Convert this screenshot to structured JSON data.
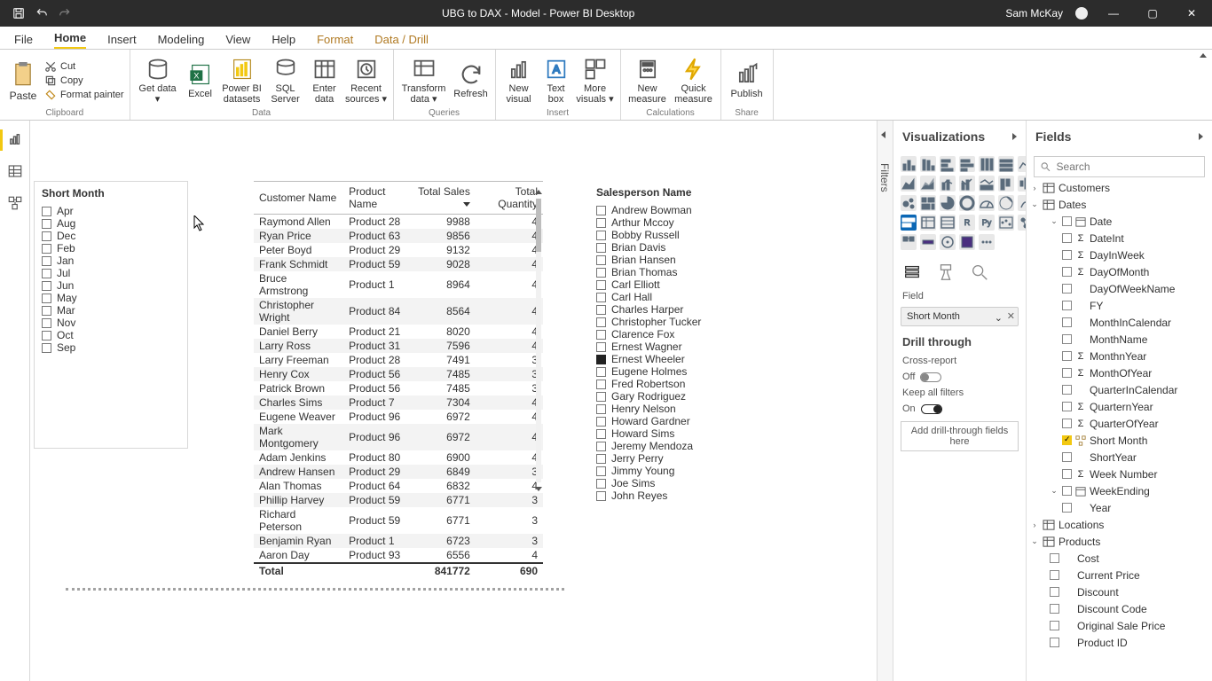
{
  "titlebar": {
    "title": "UBG to DAX - Model - Power BI Desktop",
    "user": "Sam McKay"
  },
  "tabs": {
    "file": "File",
    "home": "Home",
    "insert": "Insert",
    "modeling": "Modeling",
    "view": "View",
    "help": "Help",
    "format": "Format",
    "drill": "Data / Drill"
  },
  "ribbon": {
    "paste": "Paste",
    "cut": "Cut",
    "copy": "Copy",
    "painter": "Format painter",
    "clipboard": "Clipboard",
    "get_data": "Get data",
    "excel": "Excel",
    "pbi_ds": "Power BI datasets",
    "sql": "SQL Server",
    "enter": "Enter data",
    "recent": "Recent sources",
    "data": "Data",
    "transform": "Transform data",
    "refresh": "Refresh",
    "queries": "Queries",
    "new_visual": "New visual",
    "textbox": "Text box",
    "more_vis": "More visuals",
    "insert": "Insert",
    "new_measure": "New measure",
    "quick_measure": "Quick measure",
    "calculations": "Calculations",
    "publish": "Publish",
    "share": "Share"
  },
  "filters_tab": "Filters",
  "viz": {
    "header": "Visualizations",
    "field_section": "Field",
    "field_chip": "Short Month",
    "drill_header": "Drill through",
    "cross": "Cross-report",
    "off": "Off",
    "keep": "Keep all filters",
    "on": "On",
    "drop": "Add drill-through fields here"
  },
  "fields": {
    "header": "Fields",
    "search_ph": "Search",
    "tables": {
      "customers": "Customers",
      "dates": "Dates",
      "date": "Date",
      "dateint": "DateInt",
      "dayinweek": "DayInWeek",
      "dayofmonth": "DayOfMonth",
      "dayofweekname": "DayOfWeekName",
      "fy": "FY",
      "monthincalendar": "MonthInCalendar",
      "monthname": "MonthName",
      "monthnyear": "MonthnYear",
      "monthofyear": "MonthOfYear",
      "qic": "QuarterInCalendar",
      "qny": "QuarternYear",
      "qoy": "QuarterOfYear",
      "shortmonth": "Short Month",
      "shortyear": "ShortYear",
      "weeknum": "Week Number",
      "weekending": "WeekEnding",
      "year": "Year",
      "locations": "Locations",
      "products": "Products",
      "cost": "Cost",
      "curprice": "Current Price",
      "discount": "Discount",
      "disccode": "Discount Code",
      "origprice": "Original Sale Price",
      "productid": "Product ID"
    }
  },
  "slicer_month": {
    "title": "Short Month",
    "items": [
      "Apr",
      "Aug",
      "Dec",
      "Feb",
      "Jan",
      "Jul",
      "Jun",
      "May",
      "Mar",
      "Nov",
      "Oct",
      "Sep"
    ]
  },
  "slicer_sales": {
    "title": "Salesperson Name",
    "items": [
      "Andrew Bowman",
      "Arthur Mccoy",
      "Bobby Russell",
      "Brian Davis",
      "Brian Hansen",
      "Brian Thomas",
      "Carl Elliott",
      "Carl Hall",
      "Charles Harper",
      "Christopher Tucker",
      "Clarence Fox",
      "Ernest Wagner",
      "Ernest Wheeler",
      "Eugene Holmes",
      "Fred Robertson",
      "Gary Rodriguez",
      "Henry Nelson",
      "Howard Gardner",
      "Howard Sims",
      "Jeremy Mendoza",
      "Jerry Perry",
      "Jimmy Young",
      "Joe Sims",
      "John Reyes"
    ],
    "selected_index": 12
  },
  "data_table": {
    "cols": [
      "Customer Name",
      "Product Name",
      "Total Sales",
      "Total Quantity"
    ],
    "rows": [
      [
        "Raymond Allen",
        "Product 28",
        "9988",
        "4"
      ],
      [
        "Ryan Price",
        "Product 63",
        "9856",
        "4"
      ],
      [
        "Peter Boyd",
        "Product 29",
        "9132",
        "4"
      ],
      [
        "Frank Schmidt",
        "Product 59",
        "9028",
        "4"
      ],
      [
        "Bruce Armstrong",
        "Product 1",
        "8964",
        "4"
      ],
      [
        "Christopher Wright",
        "Product 84",
        "8564",
        "4"
      ],
      [
        "Daniel Berry",
        "Product 21",
        "8020",
        "4"
      ],
      [
        "Larry Ross",
        "Product 31",
        "7596",
        "4"
      ],
      [
        "Larry Freeman",
        "Product 28",
        "7491",
        "3"
      ],
      [
        "Henry Cox",
        "Product 56",
        "7485",
        "3"
      ],
      [
        "Patrick Brown",
        "Product 56",
        "7485",
        "3"
      ],
      [
        "Charles Sims",
        "Product 7",
        "7304",
        "4"
      ],
      [
        "Eugene Weaver",
        "Product 96",
        "6972",
        "4"
      ],
      [
        "Mark Montgomery",
        "Product 96",
        "6972",
        "4"
      ],
      [
        "Adam Jenkins",
        "Product 80",
        "6900",
        "4"
      ],
      [
        "Andrew Hansen",
        "Product 29",
        "6849",
        "3"
      ],
      [
        "Alan Thomas",
        "Product 64",
        "6832",
        "4"
      ],
      [
        "Phillip Harvey",
        "Product 59",
        "6771",
        "3"
      ],
      [
        "Richard Peterson",
        "Product 59",
        "6771",
        "3"
      ],
      [
        "Benjamin Ryan",
        "Product 1",
        "6723",
        "3"
      ],
      [
        "Aaron Day",
        "Product 93",
        "6556",
        "4"
      ]
    ],
    "total_label": "Total",
    "total_sales": "841772",
    "total_qty": "690"
  }
}
